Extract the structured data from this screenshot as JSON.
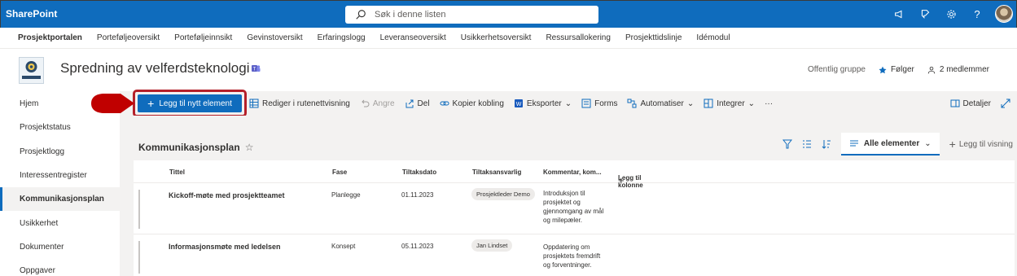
{
  "suitebar": {
    "brand": "SharePoint",
    "search_placeholder": "Søk i denne listen",
    "icons": [
      "megaphone-icon",
      "feedback-icon",
      "gear-icon",
      "help-icon",
      "avatar"
    ]
  },
  "hubnav": {
    "home": "Prosjektportalen",
    "items": [
      "Porteføljeoversikt",
      "Porteføljeinnsikt",
      "Gevinstoversikt",
      "Erfaringslogg",
      "Leveranseoversikt",
      "Usikkerhetsoversikt",
      "Ressursallokering",
      "Prosjekttidslinje",
      "Idémodul"
    ]
  },
  "site": {
    "title": "Spredning av velferdsteknologi",
    "privacy": "Offentlig gruppe",
    "follow": "Følger",
    "members": "2 medlemmer"
  },
  "leftnav": {
    "items": [
      "Hjem",
      "Prosjektstatus",
      "Prosjektlogg",
      "Interessentregister",
      "Kommunikasjonsplan",
      "Usikkerhet",
      "Dokumenter",
      "Oppgaver"
    ],
    "active_index": 4
  },
  "commandbar": {
    "new_item": "Legg til nytt element",
    "grid_edit": "Rediger i rutenettvisning",
    "undo": "Angre",
    "share": "Del",
    "copy_link": "Kopier kobling",
    "export": "Eksporter",
    "forms": "Forms",
    "automate": "Automatiser",
    "integrate": "Integrer",
    "more": "···",
    "details": "Detaljer"
  },
  "list": {
    "title": "Kommunikasjonsplan",
    "view": "Alle elementer",
    "add_view": "Legg til visning",
    "columns": [
      "Tittel",
      "Fase",
      "Tiltaksdato",
      "Tiltaksansvarlig",
      "Kommentar, kom...",
      "Legg til kolonne"
    ],
    "rows": [
      {
        "title": "Kickoff-møte med prosjektteamet",
        "phase": "Planlegge",
        "date": "01.11.2023",
        "owner": "Prosjektleder Demo",
        "comment_lines": [
          "Introduksjon til",
          "prosjektet og",
          "gjennomgang av mål",
          "og milepæler."
        ]
      },
      {
        "title": "Informasjonsmøte med ledelsen",
        "phase": "Konsept",
        "date": "05.11.2023",
        "owner": "Jan Lindset",
        "comment_lines": [
          "Oppdatering om",
          "prosjektets fremdrift",
          "og forventninger."
        ]
      }
    ]
  },
  "colors": {
    "accent": "#0f6cbd",
    "highlight": "#b4202a"
  }
}
